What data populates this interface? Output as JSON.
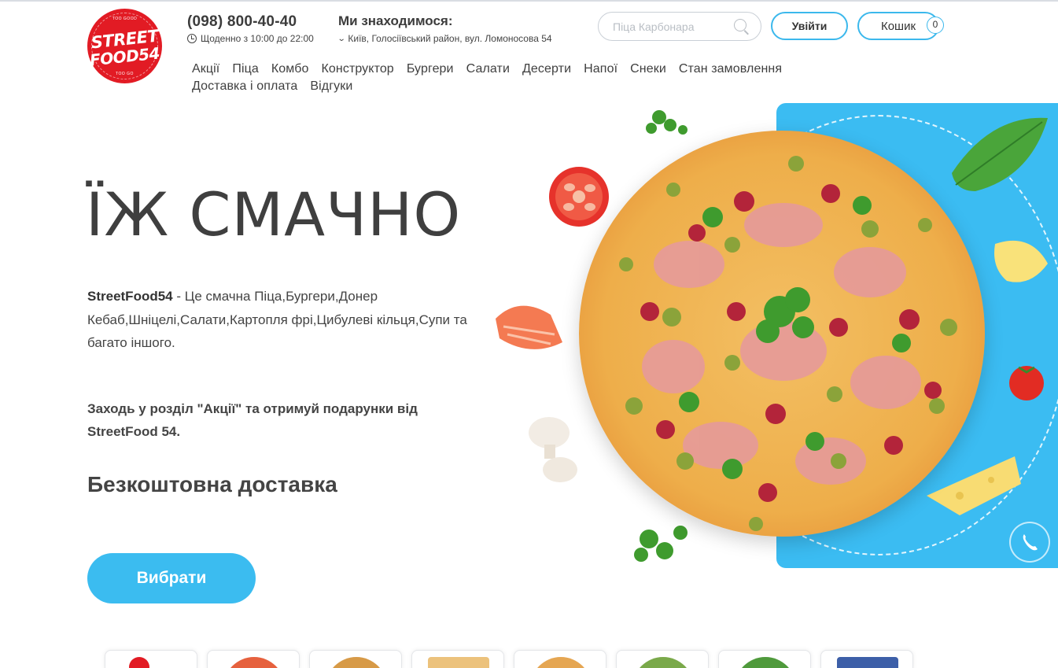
{
  "brand": {
    "logo_line1": "STREET",
    "logo_line2": "FOOD54",
    "logo_small_top": "TOO GOOD",
    "logo_small_bottom": "TOO GO",
    "color": "#e21b24"
  },
  "contacts": {
    "phone": "(098) 800-40-40",
    "hours": "Щоденно з 10:00 до 22:00",
    "location_title": "Ми знаходимося:",
    "address": "Київ, Голосіївський район, вул. Ломоносова 54"
  },
  "search": {
    "placeholder": "Піца Карбонара"
  },
  "header_buttons": {
    "login": "Увійти",
    "cart": "Кошик",
    "cart_count": "0"
  },
  "nav": [
    "Акції",
    "Піца",
    "Комбо",
    "Конструктор",
    "Бургери",
    "Салати",
    "Десерти",
    "Напої",
    "Снеки",
    "Стан замовлення",
    "Доставка і оплата",
    "Відгуки"
  ],
  "hero": {
    "headline": "ЇЖ СМАЧНО",
    "brand_bold": "StreetFood54",
    "description": " - Це смачна Піца,Бургери,Донер Кебаб,Шніцелі,Салати,Картопля фрі,Цибулеві кільця,Супи та багато іншого.",
    "promo": "Заходь у розділ \"Акції\" та отримуй подарунки від StreetFood 54.",
    "delivery": "Безкоштовна доставка",
    "cta": "Вибрати"
  },
  "colors": {
    "accent": "#3bbcf0",
    "text": "#3f3f3f"
  },
  "icons": [
    "clock-icon",
    "chevron-down-icon",
    "search-icon",
    "phone-icon"
  ]
}
